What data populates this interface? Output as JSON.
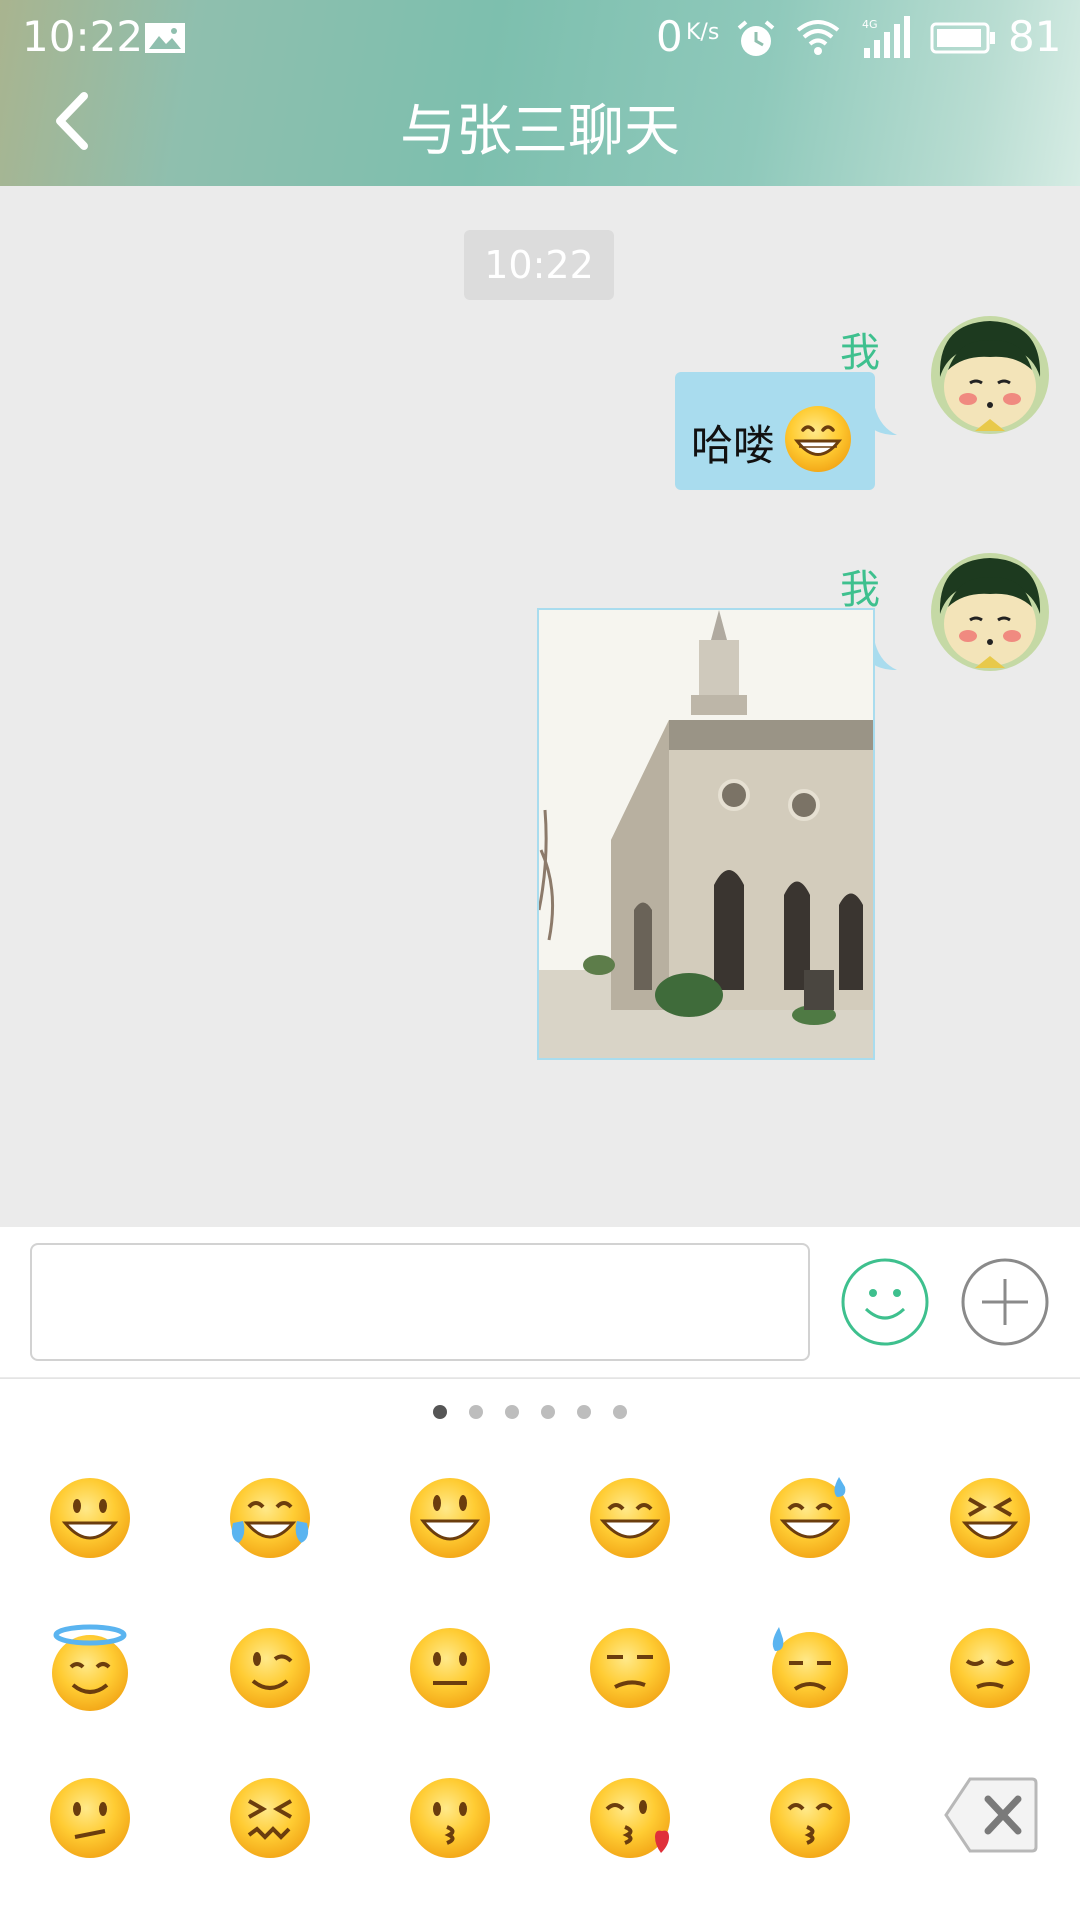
{
  "status_bar": {
    "time": "10:22",
    "network_speed": "0",
    "network_speed_unit": "K/s",
    "network_type": "4G",
    "battery": "81"
  },
  "header": {
    "title": "与张三聊天",
    "back_icon": "chevron-left-icon"
  },
  "chat": {
    "timestamp": "10:22",
    "messages": [
      {
        "sender": "我",
        "type": "text",
        "text": "哈喽",
        "emoji": "grinning-face-emoji"
      },
      {
        "sender": "我",
        "type": "image",
        "image_subject": "church-photo"
      }
    ]
  },
  "input_bar": {
    "placeholder": "",
    "value": "",
    "emoji_button_icon": "smiley-icon",
    "more_button_icon": "plus-icon"
  },
  "emoji_panel": {
    "page_count": 6,
    "active_page": 1,
    "emojis": [
      "grinning",
      "joy",
      "smiley",
      "smile",
      "sweat-smile",
      "laughing",
      "innocent",
      "wink",
      "neutral",
      "unamused",
      "cold-sweat",
      "pensive",
      "confused",
      "confounded",
      "kissing",
      "kissing-heart",
      "kissing-smiling-eyes"
    ],
    "delete_icon": "backspace-icon"
  },
  "colors": {
    "accent_green": "#3ec08e",
    "bubble_blue": "#a9dcee",
    "chat_background": "#ebebeb"
  }
}
